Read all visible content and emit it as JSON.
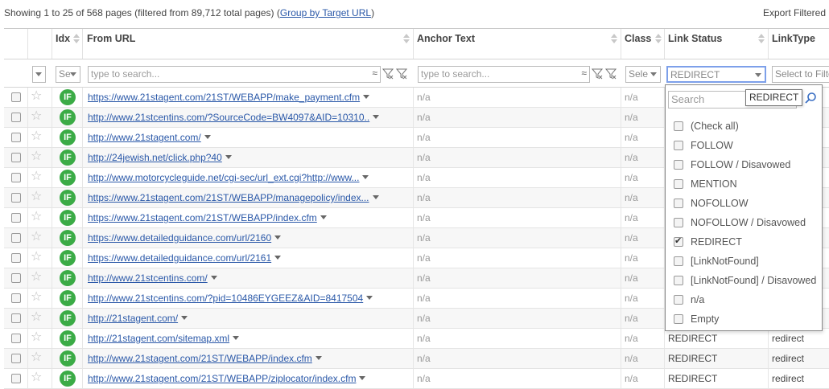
{
  "summary": {
    "text": "Showing 1 to 25 of 568 pages (filtered from 89,712 total pages) (",
    "link": "Group by Target URL",
    "tail": ")"
  },
  "export_label": "Export Filtered",
  "columns": {
    "idx": "Idx",
    "from_url": "From URL",
    "anchor": "Anchor Text",
    "class": "Class",
    "link_status": "Link Status",
    "link_type": "LinkType"
  },
  "filters": {
    "idx_value": "Se",
    "from_url_placeholder": "type to search...",
    "anchor_placeholder": "type to search...",
    "class_value": "Sele",
    "link_status_value": "REDIRECT",
    "link_type_placeholder": "Select to Filter",
    "tilde": "≈"
  },
  "badge_text": "IF",
  "rows": [
    {
      "url": "https://www.21stagent.com/21ST/WEBAPP/make_payment.cfm",
      "anchor": "n/a",
      "class": "n/a",
      "status": "",
      "type": ""
    },
    {
      "url": "http://www.21stcentins.com/?SourceCode=BW4097&AID=10310..",
      "anchor": "n/a",
      "class": "n/a",
      "status": "",
      "type": ""
    },
    {
      "url": "http://www.21stagent.com/",
      "anchor": "n/a",
      "class": "n/a",
      "status": "",
      "type": ""
    },
    {
      "url": "http://24jewish.net/click.php?40",
      "anchor": "n/a",
      "class": "n/a",
      "status": "",
      "type": ""
    },
    {
      "url": "http://www.motorcycleguide.net/cgi-sec/url_ext.cgi?http://www...",
      "anchor": "n/a",
      "class": "n/a",
      "status": "",
      "type": ""
    },
    {
      "url": "https://www.21stagent.com/21ST/WEBAPP/managepolicy/index...",
      "anchor": "n/a",
      "class": "n/a",
      "status": "",
      "type": ""
    },
    {
      "url": "https://www.21stagent.com/21ST/WEBAPP/index.cfm",
      "anchor": "n/a",
      "class": "n/a",
      "status": "",
      "type": ""
    },
    {
      "url": "https://www.detailedguidance.com/url/2160",
      "anchor": "n/a",
      "class": "n/a",
      "status": "",
      "type": ""
    },
    {
      "url": "https://www.detailedguidance.com/url/2161",
      "anchor": "n/a",
      "class": "n/a",
      "status": "",
      "type": ""
    },
    {
      "url": "http://www.21stcentins.com/",
      "anchor": "n/a",
      "class": "n/a",
      "status": "",
      "type": ""
    },
    {
      "url": "http://www.21stcentins.com/?pid=10486EYGEEZ&AID=8417504",
      "anchor": "n/a",
      "class": "n/a",
      "status": "",
      "type": ""
    },
    {
      "url": "http://21stagent.com/",
      "anchor": "n/a",
      "class": "n/a",
      "status": "",
      "type": ""
    },
    {
      "url": "http://21stagent.com/sitemap.xml",
      "anchor": "n/a",
      "class": "n/a",
      "status": "REDIRECT",
      "type": "redirect"
    },
    {
      "url": "http://www.21stagent.com/21ST/WEBAPP/index.cfm",
      "anchor": "n/a",
      "class": "n/a",
      "status": "REDIRECT",
      "type": "redirect"
    },
    {
      "url": "http://www.21stagent.com/21ST/WEBAPP/ziplocator/index.cfm",
      "anchor": "n/a",
      "class": "n/a",
      "status": "REDIRECT",
      "type": "redirect"
    }
  ],
  "dropdown": {
    "search_placeholder": "Search",
    "tooltip": "REDIRECT",
    "options": [
      {
        "label": "(Check all)",
        "checked": false
      },
      {
        "label": "FOLLOW",
        "checked": false
      },
      {
        "label": "FOLLOW / Disavowed",
        "checked": false
      },
      {
        "label": "MENTION",
        "checked": false
      },
      {
        "label": "NOFOLLOW",
        "checked": false
      },
      {
        "label": "NOFOLLOW / Disavowed",
        "checked": false
      },
      {
        "label": "REDIRECT",
        "checked": true
      },
      {
        "label": "[LinkNotFound]",
        "checked": false
      },
      {
        "label": "[LinkNotFound] / Disavowed",
        "checked": false
      },
      {
        "label": "n/a",
        "checked": false
      },
      {
        "label": "Empty",
        "checked": false
      }
    ]
  },
  "colors": {
    "link": "#2a58a8",
    "badge": "#3bab46",
    "active_filter_border": "#7da0ea"
  }
}
